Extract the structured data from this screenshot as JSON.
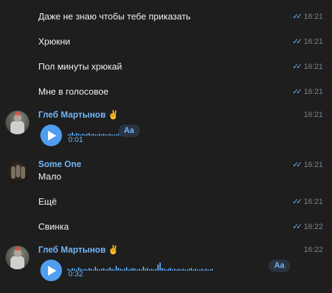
{
  "messages": [
    {
      "text": "Даже не знаю чтобы тебе приказать",
      "time": "16:21"
    },
    {
      "text": "Хрюкни",
      "time": "16:21"
    },
    {
      "text": "Пол минуты хрюкай",
      "time": "16:21"
    },
    {
      "text": "Мне в голосовое",
      "time": "16:21"
    }
  ],
  "voice1": {
    "sender": "Глеб Мартынов ✌️",
    "time": "16:21",
    "duration": "0:01",
    "transcribe_label": "Aa"
  },
  "someone": {
    "sender": "Some One",
    "messages": [
      {
        "text": "Мало",
        "time": "16:21"
      },
      {
        "text": "Ещё",
        "time": "16:21"
      },
      {
        "text": "Свинка",
        "time": "16:22"
      }
    ]
  },
  "voice2": {
    "sender": "Глеб Мартынов ✌️",
    "time": "16:22",
    "duration": "0:32",
    "transcribe_label": "Aa"
  },
  "read_ticks": "✓✓",
  "colors": {
    "background": "#1e1e1e",
    "accent": "#4f9ff0",
    "name": "#71b4f5",
    "time": "#7d858c"
  }
}
